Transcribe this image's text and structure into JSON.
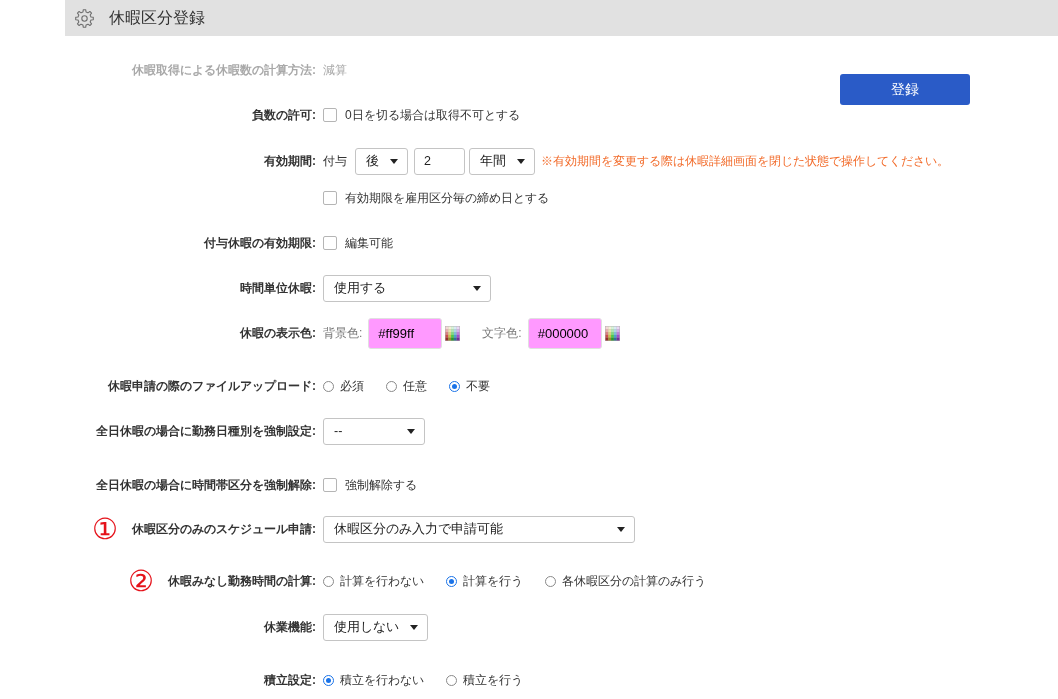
{
  "header": {
    "title": "休暇区分登録"
  },
  "register_button": {
    "label": "登録"
  },
  "fields": [
    {
      "kind": "static",
      "label": "休暇取得による休暇数の計算方法:",
      "value": "減算",
      "disabled": true
    },
    {
      "kind": "checkbox",
      "label": "負数の許可:",
      "checkbox": {
        "text": "0日を切る場合は取得不可とする",
        "checked": false
      }
    },
    {
      "kind": "period",
      "label": "有効期間:",
      "prefix": "付与",
      "direction": "後",
      "amount": "2",
      "unit": "年間",
      "notice": "※有効期間を変更する際は休暇詳細画面を閉じた状態で操作してください。"
    },
    {
      "kind": "checkbox",
      "checkbox": {
        "text": "有効期限を雇用区分毎の締め日とする",
        "checked": false
      }
    },
    {
      "kind": "checkbox",
      "label": "付与休暇の有効期限:",
      "checkbox": {
        "text": "編集可能",
        "checked": false
      }
    },
    {
      "kind": "select",
      "label": "時間単位休暇:",
      "value": "使用する"
    },
    {
      "kind": "colors",
      "label": "休暇の表示色:",
      "background": {
        "label": "背景色:",
        "value": "#ff99ff"
      },
      "text_color": {
        "label": "文字色:",
        "value": "#000000"
      }
    },
    {
      "kind": "radio",
      "label": "休暇申請の際のファイルアップロード:",
      "options": [
        {
          "text": "必須",
          "selected": false
        },
        {
          "text": "任意",
          "selected": false
        },
        {
          "text": "不要",
          "selected": true
        }
      ]
    },
    {
      "kind": "select",
      "label": "全日休暇の場合に勤務日種別を強制設定:",
      "value": "--"
    },
    {
      "kind": "checkbox",
      "label": "全日休暇の場合に時間帯区分を強制解除:",
      "checkbox": {
        "text": "強制解除する",
        "checked": false
      }
    },
    {
      "kind": "select",
      "marker": "①",
      "label": "休暇区分のみのスケジュール申請:",
      "value": "休暇区分のみ入力で申請可能"
    },
    {
      "kind": "radio",
      "marker": "②",
      "label": "休暇みなし勤務時間の計算:",
      "options": [
        {
          "text": "計算を行わない",
          "selected": false
        },
        {
          "text": "計算を行う",
          "selected": true
        },
        {
          "text": "各休暇区分の計算のみ行う",
          "selected": false
        }
      ]
    },
    {
      "kind": "select",
      "label": "休業機能:",
      "value": "使用しない"
    },
    {
      "kind": "radio",
      "label": "積立設定:",
      "options": [
        {
          "text": "積立を行わない",
          "selected": true
        },
        {
          "text": "積立を行う",
          "selected": false
        }
      ]
    }
  ]
}
